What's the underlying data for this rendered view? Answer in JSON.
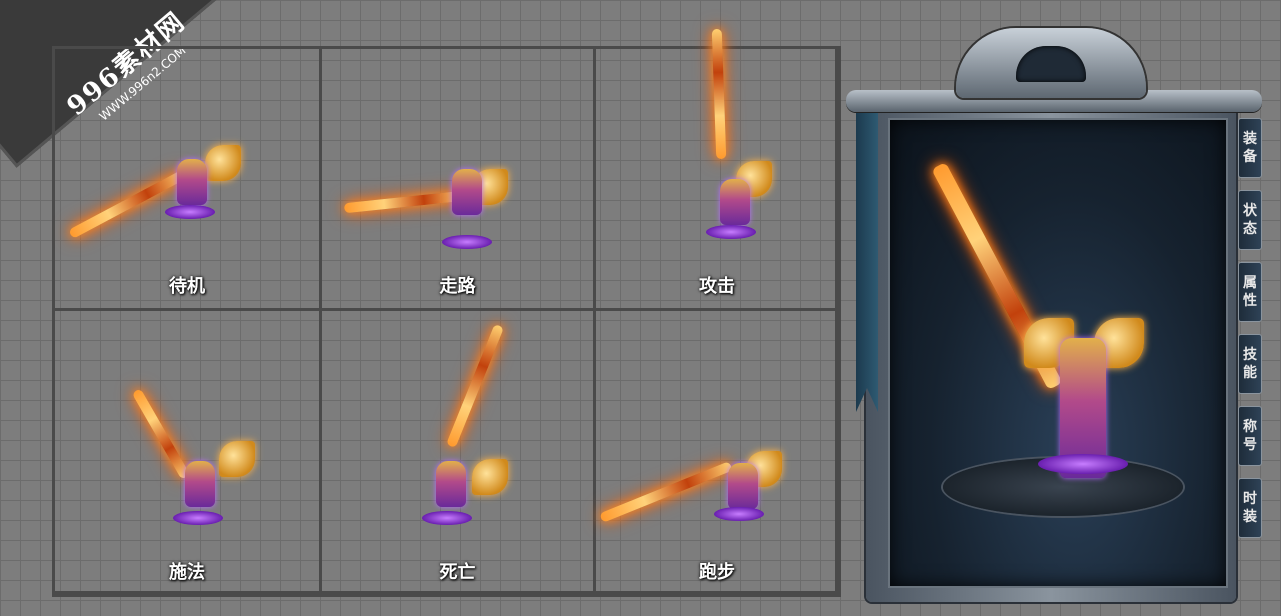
{
  "watermark": {
    "line1": "996素材网",
    "line2": "WWW.996n2.COM"
  },
  "animations": [
    {
      "label": "待机"
    },
    {
      "label": "走路"
    },
    {
      "label": "攻击"
    },
    {
      "label": "施法"
    },
    {
      "label": "死亡"
    },
    {
      "label": "跑步"
    }
  ],
  "panel": {
    "tabs": [
      {
        "top": "装",
        "bottom": "备"
      },
      {
        "top": "状",
        "bottom": "态"
      },
      {
        "top": "属",
        "bottom": "性"
      },
      {
        "top": "技",
        "bottom": "能"
      },
      {
        "top": "称",
        "bottom": "号"
      },
      {
        "top": "时",
        "bottom": "装"
      }
    ]
  }
}
